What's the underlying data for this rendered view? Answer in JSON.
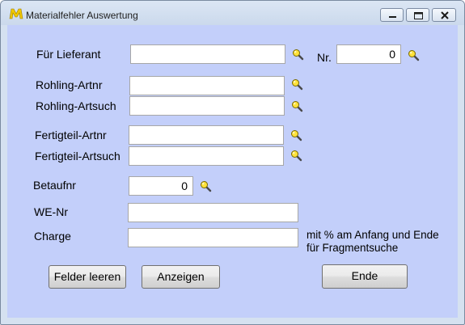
{
  "window": {
    "title": "Materialfehler Auswertung",
    "logo_text": "M"
  },
  "form": {
    "lieferant_label": "Für Lieferant",
    "lieferant_value": "",
    "nr_label": "Nr.",
    "nr_value": "0",
    "rohling_artnr_label": "Rohling-Artnr",
    "rohling_artnr_value": "",
    "rohling_artsuch_label": "Rohling-Artsuch",
    "rohling_artsuch_value": "",
    "fertigteil_artnr_label": "Fertigteil-Artnr",
    "fertigteil_artnr_value": "",
    "fertigteil_artsuch_label": "Fertigteil-Artsuch",
    "fertigteil_artsuch_value": "",
    "betaufnr_label": "Betaufnr",
    "betaufnr_value": "0",
    "we_nr_label": "WE-Nr",
    "we_nr_value": "",
    "charge_label": "Charge",
    "charge_value": "",
    "hint_line1": "mit % am Anfang und Ende",
    "hint_line2": "für Fragmentsuche"
  },
  "buttons": {
    "clear_label": "Felder leeren",
    "show_label": "Anzeigen",
    "end_label": "Ende"
  },
  "colors": {
    "client_background": "#c3cffa",
    "magnifier_lens": "#ffe23a",
    "logo": "#f0c800"
  },
  "icons": {
    "search": "magnifier-icon",
    "minimize": "minimize-icon",
    "maximize": "maximize-icon",
    "close": "close-icon"
  }
}
